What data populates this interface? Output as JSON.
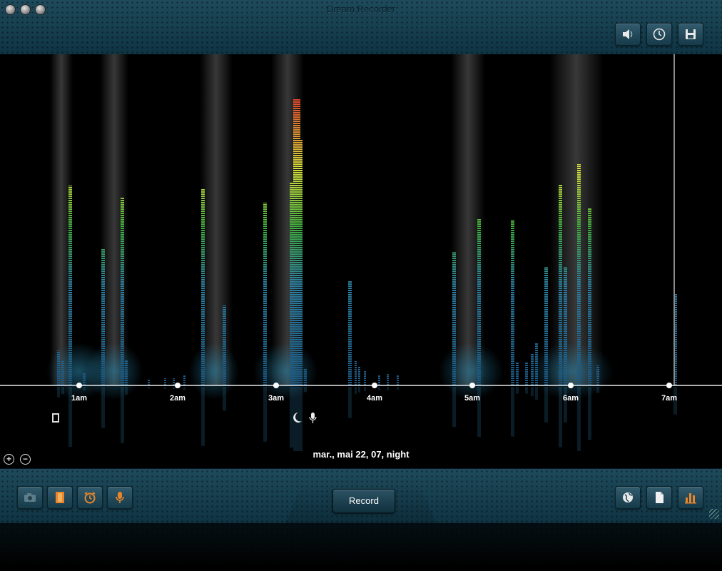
{
  "window": {
    "title": "Dream Recorder"
  },
  "top_toolbar": {
    "icons": [
      "speaker-icon",
      "clock-icon",
      "save-icon"
    ]
  },
  "graph": {
    "time_labels": [
      "1am",
      "2am",
      "3am",
      "4am",
      "5am",
      "6am",
      "7am"
    ],
    "date_label": "mar., mai 22, 07, night",
    "colors": {
      "low": "#1f5f86",
      "mid": "#3fae3f",
      "high": "#d8e03a",
      "peak": "#e0402a",
      "axis": "#e8e8e8"
    },
    "event_icons": [
      "film-icon",
      "moon-icon",
      "microphone-icon"
    ]
  },
  "zoom": {
    "in_label": "+",
    "out_label": "−"
  },
  "bottom_toolbar": {
    "left_icons": [
      "camera-icon",
      "film-icon",
      "alarm-clock-icon",
      "microphone-icon"
    ],
    "record_label": "Record",
    "right_icons": [
      "globe-icon",
      "document-icon",
      "bar-chart-icon"
    ]
  }
}
